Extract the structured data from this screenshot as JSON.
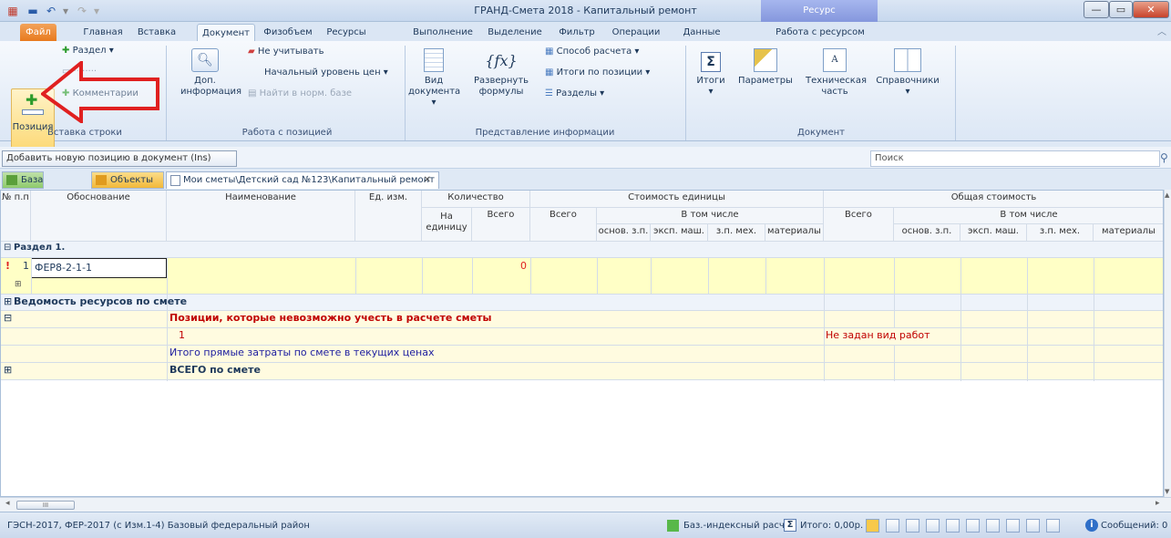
{
  "window": {
    "title": "ГРАНД-Смета 2018 - Капитальный ремонт",
    "context_tab": "Ресурс"
  },
  "tabs": [
    "Файл",
    "Главная",
    "Вставка",
    "Документ",
    "Физобъем",
    "Ресурсы",
    "Выполнение",
    "Выделение",
    "Фильтр",
    "Операции",
    "Данные",
    "Работа с ресурсом"
  ],
  "ribbon": {
    "insert_row": {
      "position": "Позиция",
      "section": "Раздел",
      "comments": "Комментарии",
      "group": "Вставка строки"
    },
    "work_with_position": {
      "dont_count": "Не учитывать",
      "price_level": "Начальный уровень цен",
      "find_norm": "Найти в норм. базе",
      "extra_info": "Доп. информация",
      "group": "Работа с позицией"
    },
    "presentation": {
      "view": "Вид документа",
      "expand": "Развернуть формулы",
      "calc_method": "Способ расчета",
      "totals_by_pos": "Итоги по позиции",
      "sections": "Разделы",
      "group": "Представление информации"
    },
    "document": {
      "totals": "Итоги",
      "params": "Параметры",
      "tech_part": "Техническая часть",
      "refs": "Справочники",
      "group": "Документ"
    }
  },
  "tooltip": "Добавить новую позицию в документ (Ins)",
  "search": {
    "placeholder": "Поиск"
  },
  "doc_tabs": {
    "base": "База",
    "objects": "Объекты",
    "path": "Мои сметы\\Детский сад №123\\Капитальный ремонт"
  },
  "grid": {
    "headers": {
      "num": "№ п.п",
      "basis": "Обоснование",
      "name": "Наименование",
      "unit": "Ед. изм.",
      "qty": "Количество",
      "qty_per": "На единицу",
      "qty_total": "Всего",
      "unit_cost": "Стоимость единицы",
      "total": "Всего",
      "incl": "В том числе",
      "osn": "основ. з.п.",
      "eksp": "эксп. маш.",
      "zpmeh": "з.п. мех.",
      "mat": "материалы",
      "total_cost": "Общая стоимость"
    },
    "section1": "Раздел 1.",
    "row1": {
      "num": "1",
      "code": "ФЕР8-2-1-1",
      "qty": "0"
    },
    "res_statement": "Ведомость ресурсов по смете",
    "cannot_count": "Позиции, которые невозможно учесть в расчете сметы",
    "cannot_row_num": "1",
    "no_work_type": "Не задан вид работ",
    "direct_costs": "Итого прямые затраты по смете в текущих ценах",
    "grand_total": "ВСЕГО по смете"
  },
  "status": {
    "base": "ГЭСН-2017, ФЕР-2017 (с Изм.1-4)  Базовый федеральный район",
    "calc": "Баз.-индексный расчет",
    "total": "Итого: 0,00р.",
    "messages": "Сообщений: 0"
  }
}
